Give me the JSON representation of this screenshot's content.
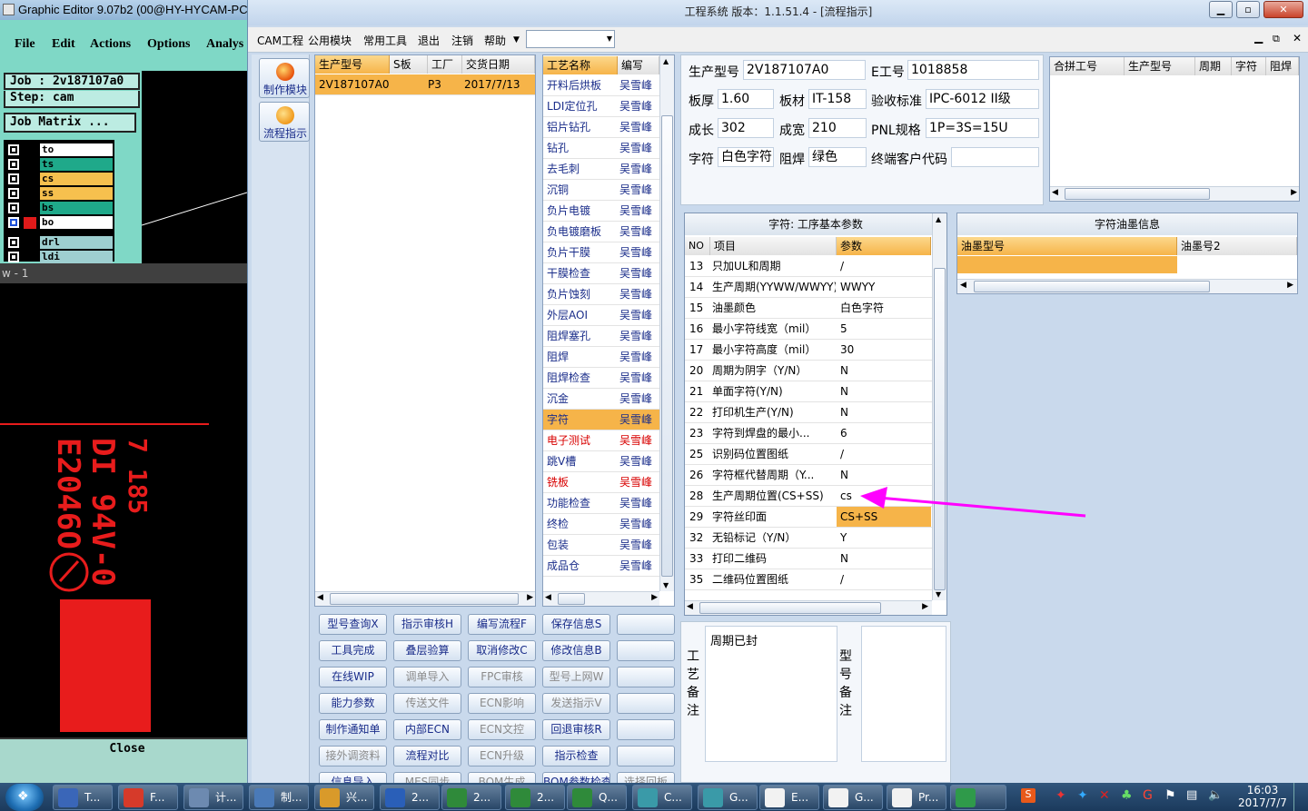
{
  "ge": {
    "title": "Graphic Editor 9.07b2 (00@HY-HYCAM-PC",
    "menu": [
      "File",
      "Edit",
      "Actions",
      "Options",
      "Analys"
    ],
    "job": "Job : 2v187107a0",
    "step": "Step: cam",
    "job_matrix": "Job Matrix ...",
    "layers": [
      {
        "name": "to",
        "color": "#ffffff"
      },
      {
        "name": "ts",
        "color": "#1fa98a"
      },
      {
        "name": "cs",
        "color": "#f6c04e"
      },
      {
        "name": "ss",
        "color": "#f6c04e"
      },
      {
        "name": "bs",
        "color": "#1fa98a"
      },
      {
        "name": "bo",
        "color": "#ffffff"
      },
      {
        "name": "drl",
        "color": "#9ecfd0"
      },
      {
        "name": "ldi",
        "color": "#9ecfd0"
      }
    ],
    "status": "w - 1",
    "close": "Close"
  },
  "window": {
    "title": "工程系统   版本：1.1.51.4 - [流程指示]",
    "menu": [
      "CAM工程",
      "公用模块",
      "常用工具",
      "退出",
      "注销",
      "帮助"
    ]
  },
  "side": {
    "btn1": "制作模块",
    "btn2": "流程指示"
  },
  "orders": {
    "headers": [
      "生产型号",
      "S板",
      "工厂",
      "交货日期"
    ],
    "row": [
      "2V187107A0",
      "",
      "P3",
      "2017/7/13"
    ]
  },
  "process": {
    "headers": [
      "工艺名称",
      "编写"
    ],
    "rows": [
      {
        "name": "开料后烘板",
        "by": "吴雪峰"
      },
      {
        "name": "LDI定位孔",
        "by": "吴雪峰"
      },
      {
        "name": "铝片钻孔",
        "by": "吴雪峰"
      },
      {
        "name": "钻孔",
        "by": "吴雪峰"
      },
      {
        "name": "去毛刺",
        "by": "吴雪峰"
      },
      {
        "name": "沉铜",
        "by": "吴雪峰"
      },
      {
        "name": "负片电镀",
        "by": "吴雪峰"
      },
      {
        "name": "负电镀磨板",
        "by": "吴雪峰"
      },
      {
        "name": "负片干膜",
        "by": "吴雪峰"
      },
      {
        "name": "干膜检查",
        "by": "吴雪峰"
      },
      {
        "name": "负片蚀刻",
        "by": "吴雪峰"
      },
      {
        "name": "外层AOI",
        "by": "吴雪峰"
      },
      {
        "name": "阻焊塞孔",
        "by": "吴雪峰"
      },
      {
        "name": "阻焊",
        "by": "吴雪峰"
      },
      {
        "name": "阻焊检查",
        "by": "吴雪峰"
      },
      {
        "name": "沉金",
        "by": "吴雪峰"
      },
      {
        "name": "字符",
        "by": "吴雪峰"
      },
      {
        "name": "电子测试",
        "by": "吴雪峰"
      },
      {
        "name": "跳V槽",
        "by": "吴雪峰"
      },
      {
        "name": "铣板",
        "by": "吴雪峰"
      },
      {
        "name": "功能检查",
        "by": "吴雪峰"
      },
      {
        "name": "终检",
        "by": "吴雪峰"
      },
      {
        "name": "包装",
        "by": "吴雪峰"
      },
      {
        "name": "成品仓",
        "by": "吴雪峰"
      }
    ]
  },
  "info": {
    "l_model": "生产型号",
    "v_model": "2V187107A0",
    "l_e": "E工号",
    "v_e": "1018858",
    "l_thick": "板厚",
    "v_thick": "1.60",
    "l_mat": "板材",
    "v_mat": "IT-158",
    "l_std": "验收标准",
    "v_std": "IPC-6012 II级",
    "l_len": "成长",
    "v_len": "302",
    "l_wid": "成宽",
    "v_wid": "210",
    "l_pnl": "PNL规格",
    "v_pnl": "1P=3S=15U",
    "l_char": "字符",
    "v_char": "白色字符",
    "l_mask": "阻焊",
    "v_mask": "绿色",
    "l_cust": "终端客户代码",
    "v_cust": ""
  },
  "merge": {
    "headers": [
      "合拼工号",
      "生产型号",
      "周期",
      "字符",
      "阻焊"
    ]
  },
  "params": {
    "title": "字符: 工序基本参数",
    "headers": [
      "NO",
      "项目",
      "参数"
    ],
    "rows": [
      {
        "no": "13",
        "item": "只加UL和周期",
        "val": "/"
      },
      {
        "no": "14",
        "item": "生产周期(YYWW/WWYY)",
        "val": "WWYY"
      },
      {
        "no": "15",
        "item": "油墨颜色",
        "val": "白色字符"
      },
      {
        "no": "16",
        "item": "最小字符线宽（mil）",
        "val": "5"
      },
      {
        "no": "17",
        "item": "最小字符高度（mil）",
        "val": "30"
      },
      {
        "no": "20",
        "item": "周期为阴字（Y/N）",
        "val": "N"
      },
      {
        "no": "21",
        "item": "单面字符(Y/N)",
        "val": "N"
      },
      {
        "no": "22",
        "item": "打印机生产(Y/N)",
        "val": "N"
      },
      {
        "no": "23",
        "item": "字符到焊盘的最小...",
        "val": "6"
      },
      {
        "no": "25",
        "item": "识别码位置图纸",
        "val": "/"
      },
      {
        "no": "26",
        "item": "字符框代替周期（Y...",
        "val": "N"
      },
      {
        "no": "28",
        "item": "生产周期位置(CS+SS)",
        "val": "cs"
      },
      {
        "no": "29",
        "item": "字符丝印面",
        "val": "CS+SS"
      },
      {
        "no": "32",
        "item": "无铅标记（Y/N）",
        "val": "Y"
      },
      {
        "no": "33",
        "item": "打印二维码",
        "val": "N"
      },
      {
        "no": "35",
        "item": "二维码位置图纸",
        "val": "/"
      }
    ]
  },
  "ink": {
    "title": "字符油墨信息",
    "headers": [
      "油墨型号",
      "油墨号2"
    ]
  },
  "remarks": {
    "process_label": "工艺备注",
    "process_text": "周期已封",
    "model_label": "型号备注"
  },
  "buttons": [
    [
      "型号查询X",
      "指示审核H",
      "编写流程F",
      "保存信息S",
      ""
    ],
    [
      "工具完成",
      "叠层验算",
      "取消修改C",
      "修改信息B",
      ""
    ],
    [
      "在线WIP",
      "调单导入",
      "FPC审核",
      "型号上网W",
      ""
    ],
    [
      "能力参数",
      "传送文件",
      "ECN影响",
      "发送指示V",
      ""
    ],
    [
      "制作通知单",
      "内部ECN",
      "ECN文控",
      "回退审核R",
      ""
    ],
    [
      "接外调资料",
      "流程对比",
      "ECN升级",
      "指示检查",
      ""
    ],
    [
      "信息导入",
      "MES同步",
      "BOM生成",
      "BOM参数检查",
      "选择回板"
    ]
  ],
  "taskbar": {
    "items": [
      "T...",
      "F...",
      "计...",
      "制...",
      "兴...",
      "2...",
      "2...",
      "2...",
      "Q...",
      "C...",
      "G...",
      "E...",
      "G...",
      "Pr...",
      ""
    ],
    "time": "16:03",
    "date": "2017/7/7"
  }
}
